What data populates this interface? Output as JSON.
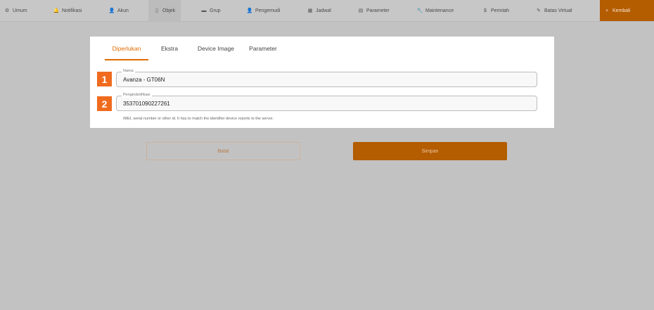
{
  "nav": {
    "items": [
      {
        "icon": "gear-icon",
        "glyph": "⚙",
        "label": "Umum"
      },
      {
        "icon": "bell-icon",
        "glyph": "🔔",
        "label": "Notifikasi"
      },
      {
        "icon": "user-icon",
        "glyph": "👤",
        "label": "Akun"
      },
      {
        "icon": "device-icon",
        "glyph": "▯",
        "label": "Objek"
      },
      {
        "icon": "folder-icon",
        "glyph": "▬",
        "label": "Grup"
      },
      {
        "icon": "driver-icon",
        "glyph": "👤",
        "label": "Pengemudi"
      },
      {
        "icon": "calendar-icon",
        "glyph": "▦",
        "label": "Jadwal"
      },
      {
        "icon": "parameter-icon",
        "glyph": "▤",
        "label": "Parameter"
      },
      {
        "icon": "wrench-icon",
        "glyph": "🔧",
        "label": "Maintenance"
      },
      {
        "icon": "command-icon",
        "glyph": "$",
        "label": "Perintah"
      },
      {
        "icon": "pencil-icon",
        "glyph": "✎",
        "label": "Batas Virtual"
      }
    ],
    "primary": {
      "icon": "plus-icon",
      "glyph": "+",
      "label": "Kembali"
    }
  },
  "tabs": [
    "Diperlukan",
    "Ekstra",
    "Device Image",
    "Parameter"
  ],
  "fields": {
    "name": {
      "badge": "1",
      "label": "Nama",
      "value": "Avanza - GT06N"
    },
    "identifier": {
      "badge": "2",
      "label": "Pengindetifikasi",
      "value": "353701090227261"
    }
  },
  "helper_text": "IMEI, serial number or other id. It has to match the identifier device reports to the server.",
  "buttons": {
    "cancel": "Batal",
    "save": "Simpan"
  },
  "colors": {
    "accent": "#e06a00",
    "primary_button": "#b35c00",
    "badge": "#f06b1e"
  }
}
